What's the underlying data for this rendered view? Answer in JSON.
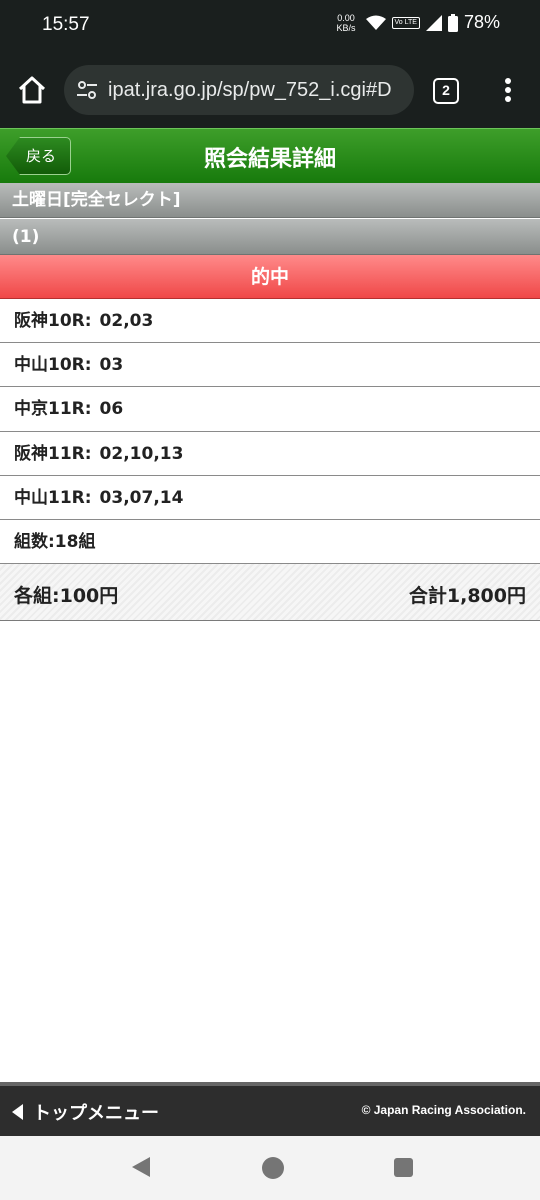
{
  "status": {
    "time": "15:57",
    "net_speed_value": "0.00",
    "net_speed_unit": "KB/s",
    "volte": "Vo LTE",
    "battery": "78%"
  },
  "browser": {
    "url": "ipat.jra.go.jp/sp/pw_752_i.cgi#D",
    "tab_count": "2"
  },
  "header": {
    "back_label": "戻る",
    "title": "照会結果詳細"
  },
  "bet": {
    "type": "土曜日[完全セレクト]",
    "number": "(1)",
    "result": "的中",
    "races": [
      {
        "race": "阪神10R:",
        "selection": "02,03"
      },
      {
        "race": "中山10R:",
        "selection": "03"
      },
      {
        "race": "中京11R:",
        "selection": "06"
      },
      {
        "race": "阪神11R:",
        "selection": "02,10,13"
      },
      {
        "race": "中山11R:",
        "selection": "03,07,14"
      }
    ],
    "combinations": "組数:18組",
    "per_unit": "各組:100円",
    "total": "合計1,800円"
  },
  "footer": {
    "menu_label": "トップメニュー",
    "copyright": "© Japan Racing Association."
  },
  "colors": {
    "title_green": "#177a0c",
    "hit_red": "#f04848",
    "gray_bar": "#8a8e8c"
  }
}
